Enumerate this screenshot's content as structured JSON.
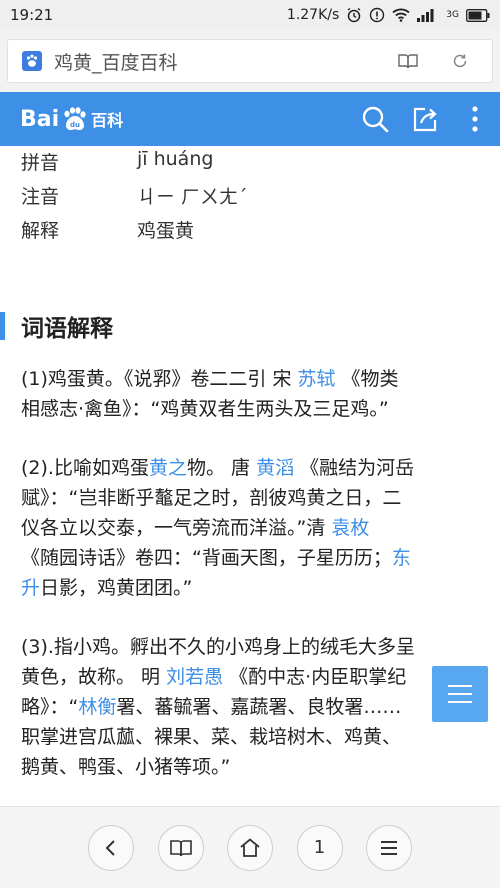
{
  "status_bar": {
    "time": "19:21",
    "net_speed": "1.27K/s",
    "network": "3G",
    "battery_icon": "battery-icon"
  },
  "browser": {
    "tab_title": "鸡黄_百度百科",
    "favicon": "baidu-paw-icon",
    "reader_icon": "book-icon",
    "refresh_icon": "refresh-icon"
  },
  "header": {
    "logo_text_1": "Bai",
    "logo_text_2": "百科",
    "search_icon": "search-icon",
    "share_icon": "share-icon",
    "more_icon": "more-vertical-icon"
  },
  "info": [
    {
      "label": "拼音",
      "value": "jī huáng"
    },
    {
      "label": "注音",
      "value": "ㄐㄧ ㄏㄨㄤˊ"
    },
    {
      "label": "解释",
      "value": "鸡蛋黄"
    }
  ],
  "section": {
    "title": "词语解释"
  },
  "paragraphs": {
    "p1": {
      "l1a": "(1)鸡蛋黄。《说郛》卷二二引 宋 ",
      "l1b": "苏轼",
      "l1c": " 《物类",
      "l2": "相感志·禽鱼》：“鸡黄双者生两头及三足鸡。”"
    },
    "p2": {
      "l1a": "(2).比喻如鸡蛋",
      "l1b": "黄之",
      "l1c": "物。 唐 ",
      "l1d": "黄滔",
      "l1e": " 《融结为河岳",
      "l2": "赋》：“岂非断乎鼇足之时，剖彼鸡黄之日，二",
      "l3a": "仪各立以交泰，一气旁流而洋溢。”清 ",
      "l3b": "袁枚",
      "l4a": "《随园诗话》卷四：“背画天图，子星历历；",
      "l4b": "东",
      "l5a": "升",
      "l5b": "日影，鸡黄团团。”"
    },
    "p3": {
      "l1": "(3).指小鸡。孵出不久的小鸡身上的绒毛大多呈",
      "l2a": "黄色，故称。 明 ",
      "l2b": "刘若愚",
      "l2c": " 《酌中志·内臣职掌纪",
      "l3a": "略》：“",
      "l3b": "林衡",
      "l3c": "署、蕃毓署、嘉蔬署、良牧署……",
      "l4": "职掌进宫瓜蓏、裸果、菜、栽培树木、鸡黄、",
      "l5": "鹅黄、鸭蛋、小猪等项。”"
    }
  },
  "float_menu_icon": "menu-icon",
  "bottom_nav": {
    "back_icon": "back-icon",
    "bookmark_icon": "bookmark-book-icon",
    "home_icon": "home-icon",
    "tabs_count": "1",
    "menu_icon": "menu-icon"
  },
  "colors": {
    "accent": "#3e8fe6",
    "link": "#3e8fe6"
  }
}
